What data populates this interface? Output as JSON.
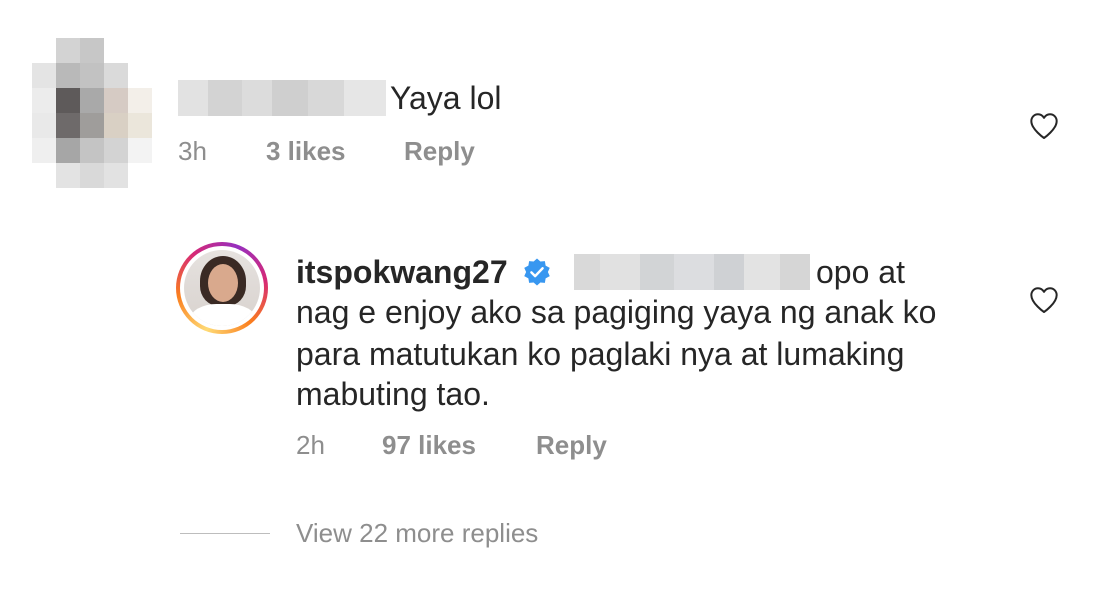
{
  "comments": [
    {
      "text_lines": [
        "Yaya lol"
      ],
      "time": "3h",
      "likes": "3 likes",
      "reply_label": "Reply"
    },
    {
      "username": "itspokwang27",
      "verified": true,
      "text_lines": [
        "opo at",
        "nag e enjoy ako sa pagiging yaya ng anak ko",
        "para matutukan ko paglaki nya at lumaking",
        "mabuting tao."
      ],
      "time": "2h",
      "likes": "97 likes",
      "reply_label": "Reply"
    }
  ],
  "view_more_replies": "View 22 more replies",
  "colors": {
    "text": "#262626",
    "meta": "#8e8e8e",
    "verified_badge": "#3897f0"
  },
  "icons": [
    "heart-outline-icon",
    "verified-badge-icon"
  ]
}
